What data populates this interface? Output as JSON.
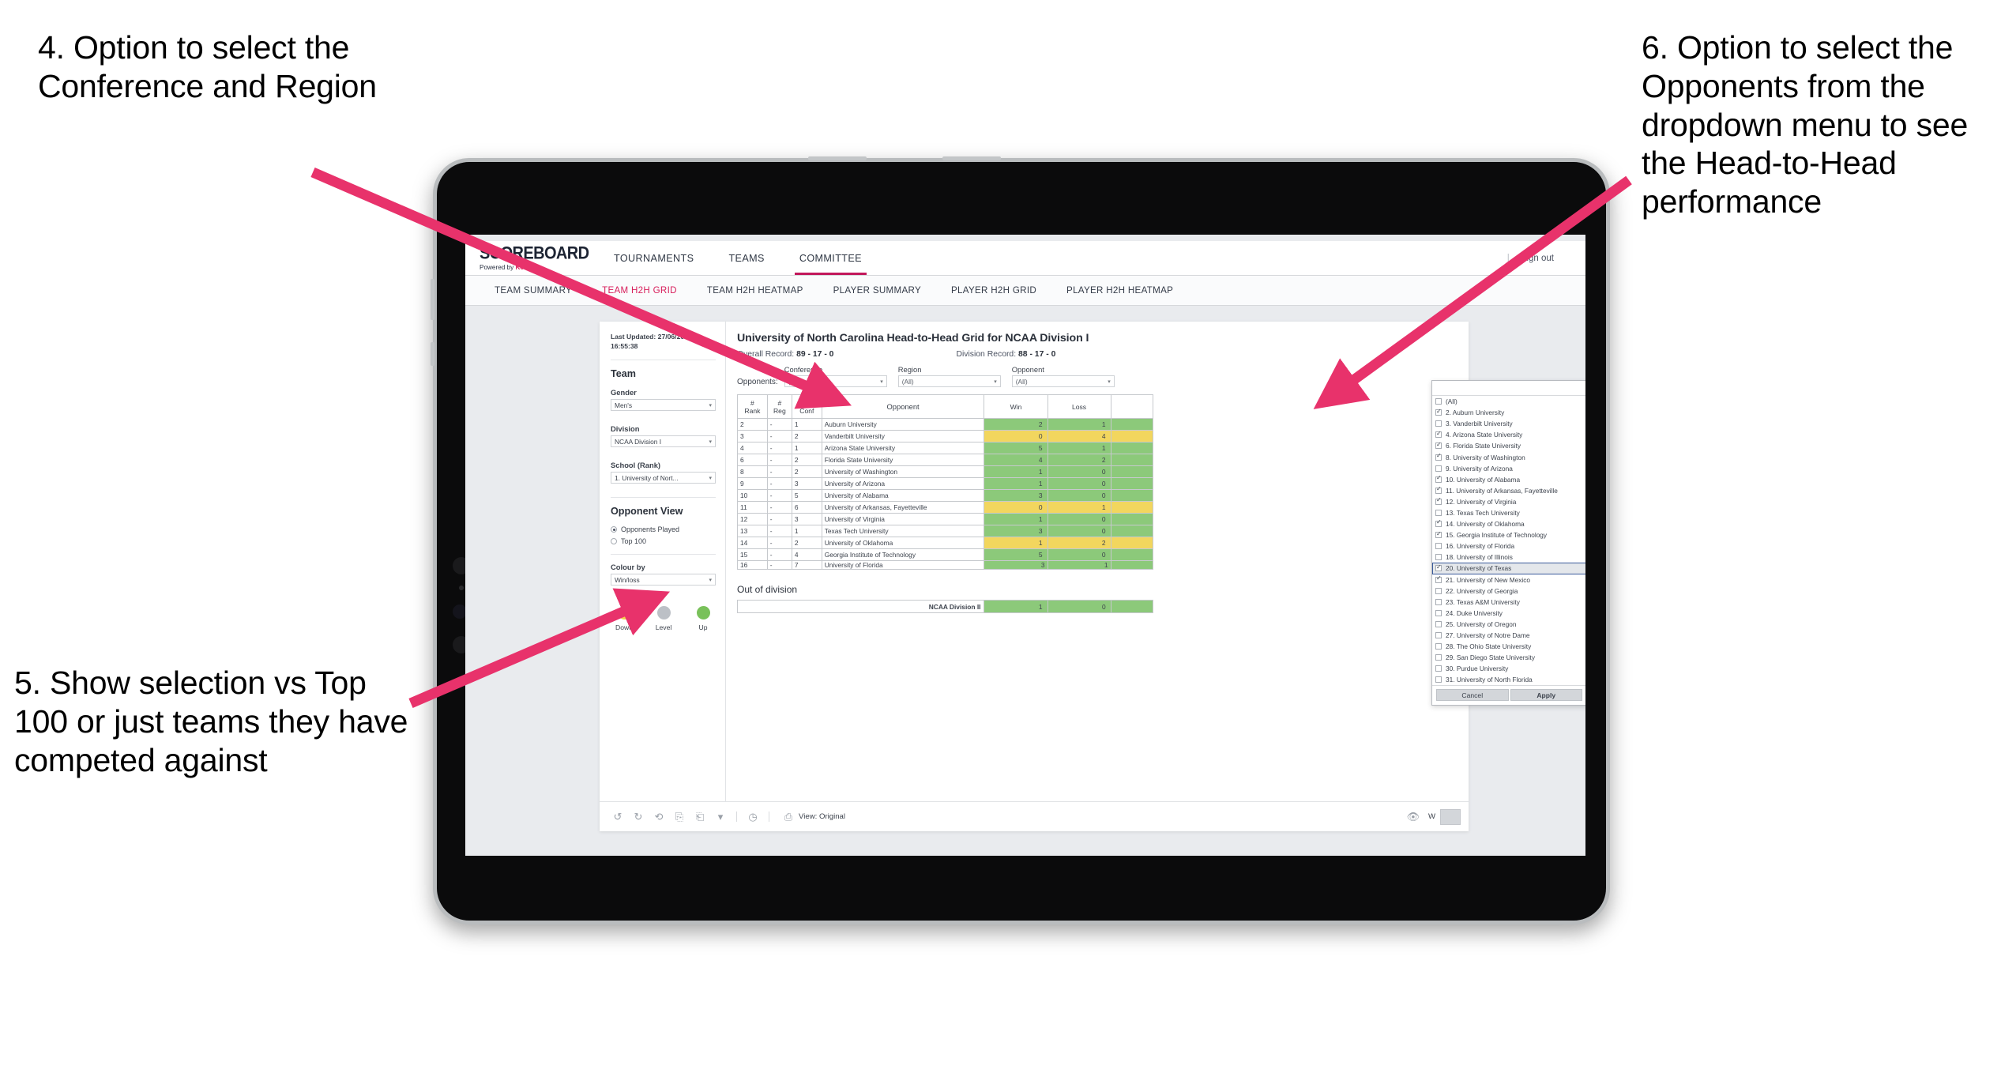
{
  "annotations": [
    {
      "id": "anno-4",
      "text": "4. Option to select the Conference and Region"
    },
    {
      "id": "anno-5",
      "text": "5. Show selection vs Top 100 or just teams they have competed against"
    },
    {
      "id": "anno-6",
      "text": "6. Option to select the Opponents from the dropdown menu to see the Head-to-Head performance"
    }
  ],
  "brand": {
    "logo_main": "SCOREBOARD",
    "logo_sub_prefix": "Powered by ",
    "logo_sub_brand": "Kood"
  },
  "topnav": {
    "items": [
      {
        "label": "TOURNAMENTS",
        "active": false
      },
      {
        "label": "TEAMS",
        "active": false
      },
      {
        "label": "COMMITTEE",
        "active": true
      }
    ],
    "divider": "|",
    "signout": "Sign out"
  },
  "subnav": {
    "items": [
      {
        "label": "TEAM SUMMARY",
        "active": false
      },
      {
        "label": "TEAM H2H GRID",
        "active": true
      },
      {
        "label": "TEAM H2H HEATMAP",
        "active": false
      },
      {
        "label": "PLAYER SUMMARY",
        "active": false
      },
      {
        "label": "PLAYER H2H GRID",
        "active": false
      },
      {
        "label": "PLAYER H2H HEATMAP",
        "active": false
      }
    ]
  },
  "sidebar": {
    "last_updated_line1": "Last Updated: 27/06/2024",
    "last_updated_line2": "16:55:38",
    "team_section_title": "Team",
    "gender_label": "Gender",
    "gender_value": "Men's",
    "division_label": "Division",
    "division_value": "NCAA Division I",
    "school_label": "School (Rank)",
    "school_value": "1. University of Nort...",
    "opponent_view_title": "Opponent View",
    "opponent_view_options": [
      {
        "label": "Opponents Played",
        "selected": true
      },
      {
        "label": "Top 100",
        "selected": false
      }
    ],
    "colour_by_label": "Colour by",
    "colour_by_value": "Win/loss",
    "legend": [
      {
        "label": "Down",
        "color": "#f2cf4a"
      },
      {
        "label": "Level",
        "color": "#bcc0c6"
      },
      {
        "label": "Up",
        "color": "#79c15a"
      }
    ]
  },
  "main": {
    "title": "University of North Carolina Head-to-Head Grid for NCAA Division I",
    "overall_record_label": "Overall Record:",
    "overall_record_value": "89 - 17 - 0",
    "division_record_label": "Division Record:",
    "division_record_value": "88 - 17 - 0",
    "opponents_inline_label": "Opponents:",
    "filters": [
      {
        "label": "Conference",
        "value": "(All)"
      },
      {
        "label": "Region",
        "value": "(All)"
      },
      {
        "label": "Opponent",
        "value": "(All)"
      }
    ],
    "out_of_division_title": "Out of division",
    "out_of_division_row": {
      "name": "NCAA Division II",
      "win": "1",
      "loss": "0",
      "color": "up"
    }
  },
  "chart_data": {
    "type": "table",
    "title": "University of North Carolina Head-to-Head Grid for NCAA Division I",
    "columns": [
      "# Rank",
      "# Reg",
      "# Conf",
      "Opponent",
      "Win",
      "Loss"
    ],
    "column_headers_multiline": [
      {
        "l1": "#",
        "l2": "Rank"
      },
      {
        "l1": "#",
        "l2": "Reg"
      },
      {
        "l1": "#",
        "l2": "Conf"
      },
      {
        "l1": "",
        "l2": "Opponent"
      },
      {
        "l1": "",
        "l2": "Win"
      },
      {
        "l1": "",
        "l2": "Loss"
      }
    ],
    "rows": [
      {
        "rank": "2",
        "reg": "-",
        "conf": "1",
        "opponent": "Auburn University",
        "win": "2",
        "loss": "1",
        "color": "up"
      },
      {
        "rank": "3",
        "reg": "-",
        "conf": "2",
        "opponent": "Vanderbilt University",
        "win": "0",
        "loss": "4",
        "color": "down"
      },
      {
        "rank": "4",
        "reg": "-",
        "conf": "1",
        "opponent": "Arizona State University",
        "win": "5",
        "loss": "1",
        "color": "up"
      },
      {
        "rank": "6",
        "reg": "-",
        "conf": "2",
        "opponent": "Florida State University",
        "win": "4",
        "loss": "2",
        "color": "up"
      },
      {
        "rank": "8",
        "reg": "-",
        "conf": "2",
        "opponent": "University of Washington",
        "win": "1",
        "loss": "0",
        "color": "up"
      },
      {
        "rank": "9",
        "reg": "-",
        "conf": "3",
        "opponent": "University of Arizona",
        "win": "1",
        "loss": "0",
        "color": "up"
      },
      {
        "rank": "10",
        "reg": "-",
        "conf": "5",
        "opponent": "University of Alabama",
        "win": "3",
        "loss": "0",
        "color": "up"
      },
      {
        "rank": "11",
        "reg": "-",
        "conf": "6",
        "opponent": "University of Arkansas, Fayetteville",
        "win": "0",
        "loss": "1",
        "color": "down"
      },
      {
        "rank": "12",
        "reg": "-",
        "conf": "3",
        "opponent": "University of Virginia",
        "win": "1",
        "loss": "0",
        "color": "up"
      },
      {
        "rank": "13",
        "reg": "-",
        "conf": "1",
        "opponent": "Texas Tech University",
        "win": "3",
        "loss": "0",
        "color": "up"
      },
      {
        "rank": "14",
        "reg": "-",
        "conf": "2",
        "opponent": "University of Oklahoma",
        "win": "1",
        "loss": "2",
        "color": "down"
      },
      {
        "rank": "15",
        "reg": "-",
        "conf": "4",
        "opponent": "Georgia Institute of Technology",
        "win": "5",
        "loss": "0",
        "color": "up"
      },
      {
        "rank": "16",
        "reg": "-",
        "conf": "7",
        "opponent": "University of Florida",
        "win": "3",
        "loss": "1",
        "color": "up",
        "clipped": true
      }
    ],
    "colors": {
      "up": "#8cc97a",
      "down": "#f2d65e",
      "level": "#bcc0c6"
    },
    "legend_position": "sidebar"
  },
  "opponent_dropdown": {
    "search_value": "",
    "options": [
      {
        "label": "(All)",
        "checked": false
      },
      {
        "label": "2. Auburn University",
        "checked": true
      },
      {
        "label": "3. Vanderbilt University",
        "checked": false
      },
      {
        "label": "4. Arizona State University",
        "checked": true
      },
      {
        "label": "6. Florida State University",
        "checked": true
      },
      {
        "label": "8. University of Washington",
        "checked": true
      },
      {
        "label": "9. University of Arizona",
        "checked": false
      },
      {
        "label": "10. University of Alabama",
        "checked": true
      },
      {
        "label": "11. University of Arkansas, Fayetteville",
        "checked": true
      },
      {
        "label": "12. University of Virginia",
        "checked": true
      },
      {
        "label": "13. Texas Tech University",
        "checked": false
      },
      {
        "label": "14. University of Oklahoma",
        "checked": true
      },
      {
        "label": "15. Georgia Institute of Technology",
        "checked": true
      },
      {
        "label": "16. University of Florida",
        "checked": false
      },
      {
        "label": "18. University of Illinois",
        "checked": false
      },
      {
        "label": "20. University of Texas",
        "checked": true,
        "highlighted": true
      },
      {
        "label": "21. University of New Mexico",
        "checked": true
      },
      {
        "label": "22. University of Georgia",
        "checked": false
      },
      {
        "label": "23. Texas A&M University",
        "checked": false
      },
      {
        "label": "24. Duke University",
        "checked": false
      },
      {
        "label": "25. University of Oregon",
        "checked": false
      },
      {
        "label": "27. University of Notre Dame",
        "checked": false
      },
      {
        "label": "28. The Ohio State University",
        "checked": false
      },
      {
        "label": "29. San Diego State University",
        "checked": false
      },
      {
        "label": "30. Purdue University",
        "checked": false
      },
      {
        "label": "31. University of North Florida",
        "checked": false
      }
    ],
    "cancel_label": "Cancel",
    "apply_label": "Apply"
  },
  "toolbar": {
    "view_label": "View: Original",
    "watch_label": "W"
  },
  "accent_colors": {
    "pink": "#e8326b",
    "brand_pink": "#d81e5b",
    "active_tab": "#c2185b"
  }
}
